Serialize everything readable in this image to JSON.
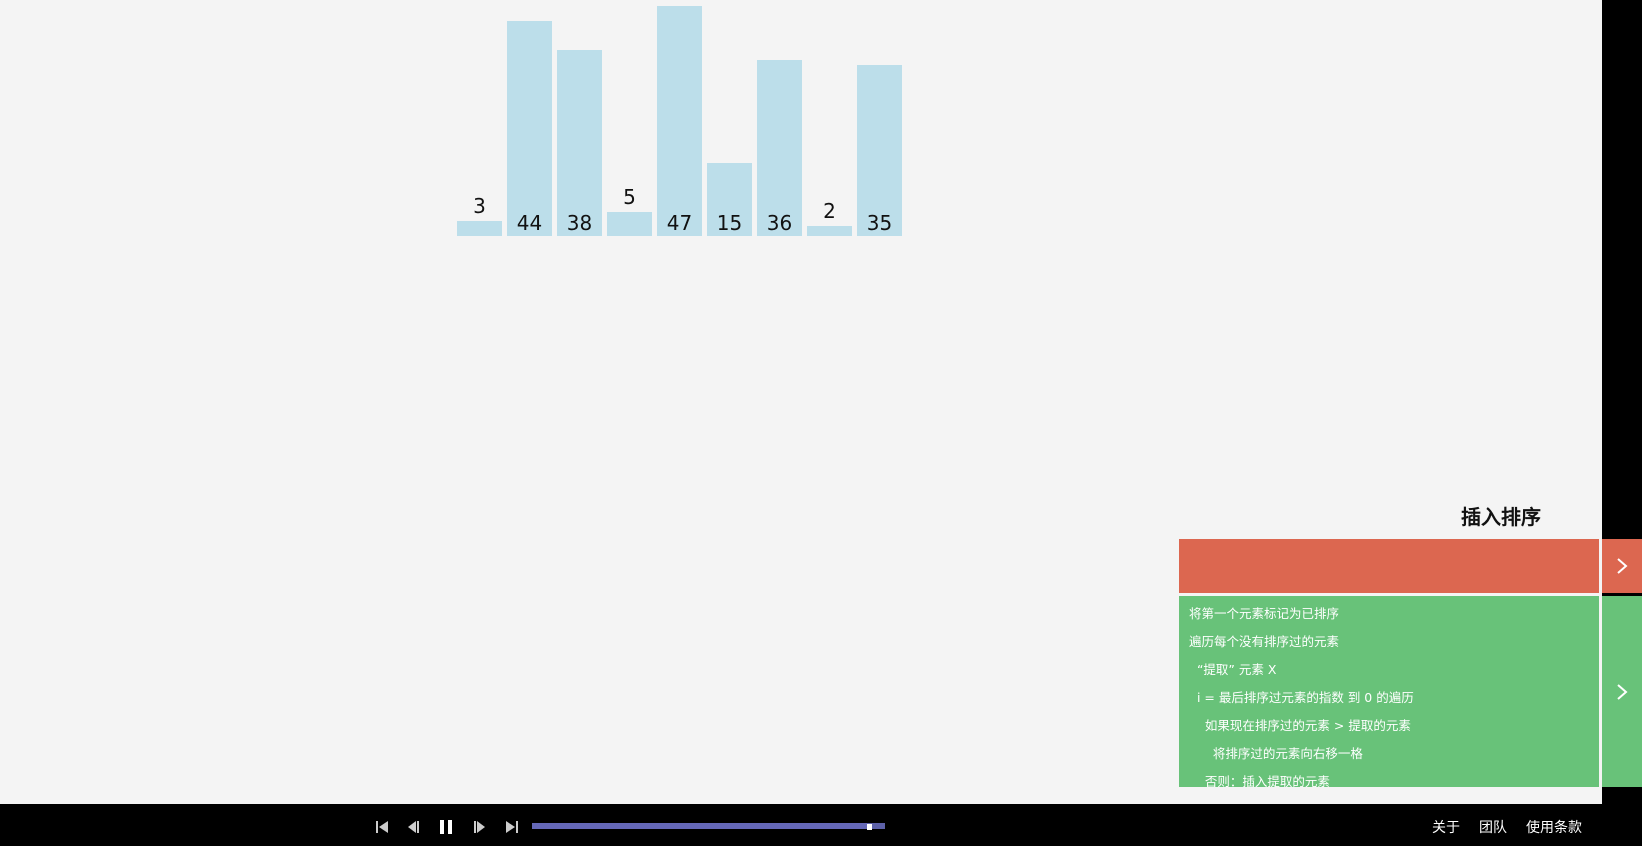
{
  "chart_data": {
    "type": "bar",
    "values": [
      3,
      44,
      38,
      5,
      47,
      15,
      36,
      2,
      35
    ]
  },
  "algorithm": {
    "title": "插入排序"
  },
  "status": {
    "text": ""
  },
  "code": {
    "lines": [
      "将第一个元素标记为已排序",
      "遍历每个没有排序过的元素",
      "  “提取” 元素 X",
      "  i = 最后排序过元素的指数 到 0 的遍历",
      "    如果现在排序过的元素 > 提取的元素",
      "      将排序过的元素向右移一格",
      "    否则：插入提取的元素"
    ]
  },
  "playback": {
    "progress": 0.95
  },
  "footer": {
    "about": "关于",
    "team": "团队",
    "terms": "使用条款"
  },
  "colors": {
    "bar": "#bcdeea",
    "status_panel": "#dc6750",
    "code_panel": "#68c279",
    "progress": "#6568b8"
  },
  "icons": {
    "skip_back": "skip-to-start-icon",
    "step_back": "step-back-icon",
    "pause": "pause-icon",
    "step_forward": "step-forward-icon",
    "skip_end": "skip-to-end-icon",
    "panel_toggle": "chevron-right-icon"
  }
}
